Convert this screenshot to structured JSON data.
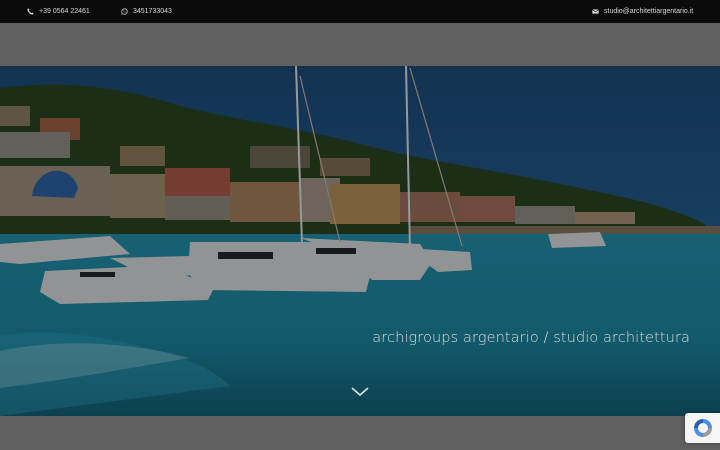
{
  "topbar": {
    "phone": "+39 0564 22461",
    "whatsapp": "3451733043",
    "email": "studio@architettiargentario.it",
    "icons": {
      "phone": "phone-icon",
      "whatsapp": "whatsapp-icon",
      "email": "envelope-icon"
    }
  },
  "hero": {
    "tagline": "archigroups argentario / studio architettura",
    "scroll_icon": "chevron-down-icon"
  },
  "recaptcha": {
    "icon": "recaptcha-icon"
  },
  "colors": {
    "topbar": "#0b0b0b",
    "band": "#5f5f5f",
    "water": "#1f7f96",
    "sky": "#1e4f7a"
  }
}
